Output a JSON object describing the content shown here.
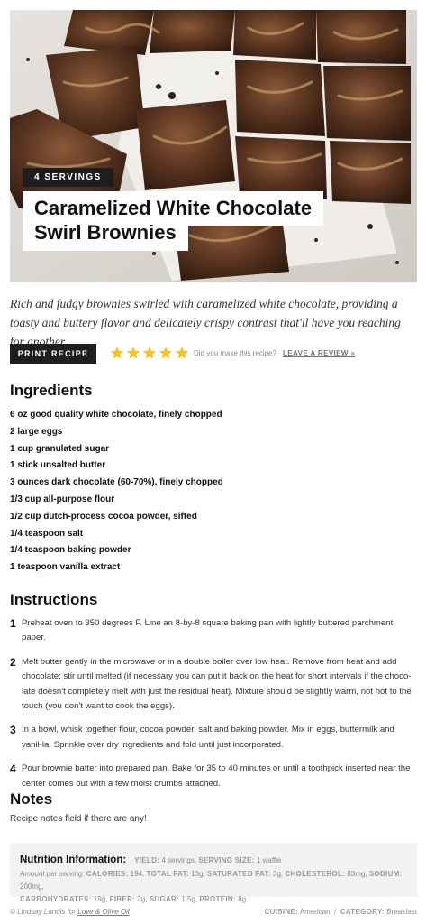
{
  "recipe": {
    "servings_badge": "4 SERVINGS",
    "title_line1": "Caramelized White Chocolate",
    "title_line2": "Swirl Brownies",
    "description": "Rich and fudgy brownies swirled with caramelized white chocolate, providing a toasty and buttery flavor and delicately crispy contrast that'll have you reaching for another.",
    "print_label": "PRINT RECIPE",
    "rating_stars": 5,
    "made_prompt": "Did you make this recipe?",
    "review_label": "LEAVE A REVIEW »"
  },
  "ingredients": {
    "heading": "Ingredients",
    "items": [
      "6 oz good quality white chocolate, finely chopped",
      "2 large eggs",
      "1 cup granulated sugar",
      "1 stick unsalted butter",
      "3 ounces dark chocolate (60-70%), finely chopped",
      "1/3 cup all-purpose flour",
      "1/2 cup dutch-process cocoa powder, sifted",
      "1/4 teaspoon salt",
      "1/4 teaspoon baking powder",
      "1 teaspoon vanilla extract"
    ]
  },
  "instructions": {
    "heading": "Instructions",
    "steps": [
      {
        "num": "1",
        "text": "Preheat oven to 350 degrees F. Line an 8-by-8 square baking pan with lightly buttered parchment paper."
      },
      {
        "num": "2",
        "text": "Melt butter gently in the microwave or in a double boiler over low heat. Remove from heat and add chocolate; stir until melted (if necessary you can put it back on the heat for short intervals if the choco-late doesn't completely melt with just the residual heat). Mixture should be slightly warm, not hot to the touch (you don't want to cook the eggs)."
      },
      {
        "num": "3",
        "text": "In a bowl, whisk together flour, cocoa powder, salt and baking powder. Mix in eggs, buttermilk and vanil-la. Sprinkle over dry ingredients and fold until just incorporated."
      },
      {
        "num": "4",
        "text": "Pour brownie batter into prepared pan. Bake for 35 to 40 minutes or until a toothpick inserted near the center comes out with a few moist crumbs attached."
      }
    ]
  },
  "notes": {
    "heading": "Notes",
    "text": "Recipe notes field if there are any!"
  },
  "nutrition": {
    "title": "Nutrition Information:",
    "yield_label": "YIELD:",
    "yield_value": "4 servings,",
    "serving_label": "SERVING SIZE:",
    "serving_value": "1 waffle",
    "amount_label": "Amount per serving:",
    "calories_label": "CALORIES:",
    "calories_value": "194,",
    "fat_label": "TOTAL FAT:",
    "fat_value": "13g,",
    "satfat_label": "SATURATED FAT:",
    "satfat_value": "3g,",
    "chol_label": "CHOLESTEROL:",
    "chol_value": "83mg,",
    "sodium_label": "SODIUM:",
    "sodium_value": "200mg,",
    "carb_label": "CARBOHYDRATES:",
    "carb_value": "19g,",
    "fiber_label": "FIBER:",
    "fiber_value": "2g,",
    "sugar_label": "SUGAR:",
    "sugar_value": "1.5g,",
    "protein_label": "PROTEIN:",
    "protein_value": "8g"
  },
  "footer": {
    "credit_prefix": "© Lindsay Landis for",
    "credit_link": "Love & Olive Oil",
    "cuisine_label": "CUISINE:",
    "cuisine_value": "American",
    "separator": "/",
    "category_label": "CATEGORY:",
    "category_value": "Breakfast"
  },
  "colors": {
    "star": "#f5c518",
    "dark_button": "#1e1e1e",
    "nutrition_bg": "#f2f2f2"
  }
}
